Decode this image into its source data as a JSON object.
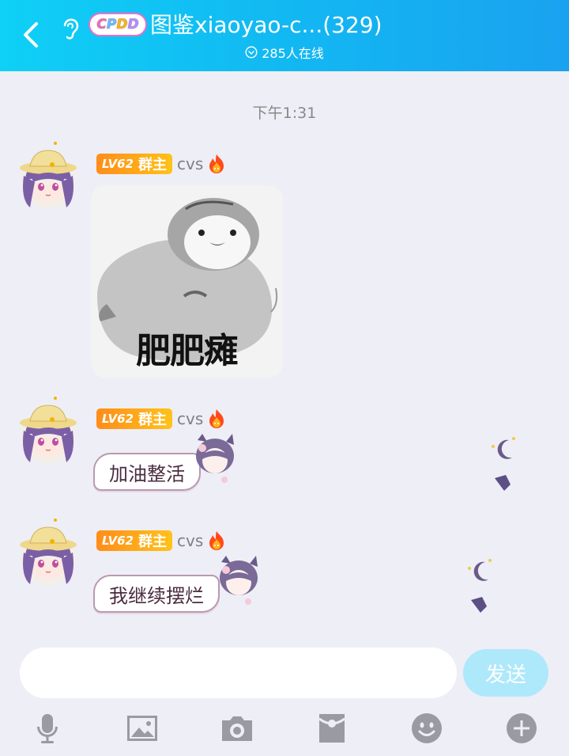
{
  "header": {
    "title": "图鉴xiaoyao-c...(329)",
    "online": "285人在线",
    "logo_text": [
      "C",
      "P",
      "D",
      "D"
    ],
    "logo_colors": [
      "#f46ab8",
      "#6fb9ff",
      "#ffd23a",
      "#b68cff"
    ]
  },
  "timestamp": "下午1:31",
  "messages": [
    {
      "level": "LV62",
      "role": "群主",
      "username": "cvs",
      "type": "sticker",
      "sticker_caption": "肥肥瘫"
    },
    {
      "level": "LV62",
      "role": "群主",
      "username": "cvs",
      "type": "text",
      "text": "加油整活"
    },
    {
      "level": "LV62",
      "role": "群主",
      "username": "cvs",
      "type": "text",
      "text": "我继续摆烂"
    }
  ],
  "input": {
    "placeholder": "",
    "send_label": "发送"
  },
  "toolbar": {
    "items": [
      "microphone-icon",
      "image-icon",
      "camera-icon",
      "red-packet-icon",
      "emoji-icon",
      "plus-icon"
    ]
  },
  "colors": {
    "header_start": "#0fd0f6",
    "header_end": "#1aa2f0",
    "background": "#eeeef6",
    "level_badge": "#ff8d1a",
    "send_button": "#aee8fb",
    "bubble_border": "#b89ab0"
  }
}
